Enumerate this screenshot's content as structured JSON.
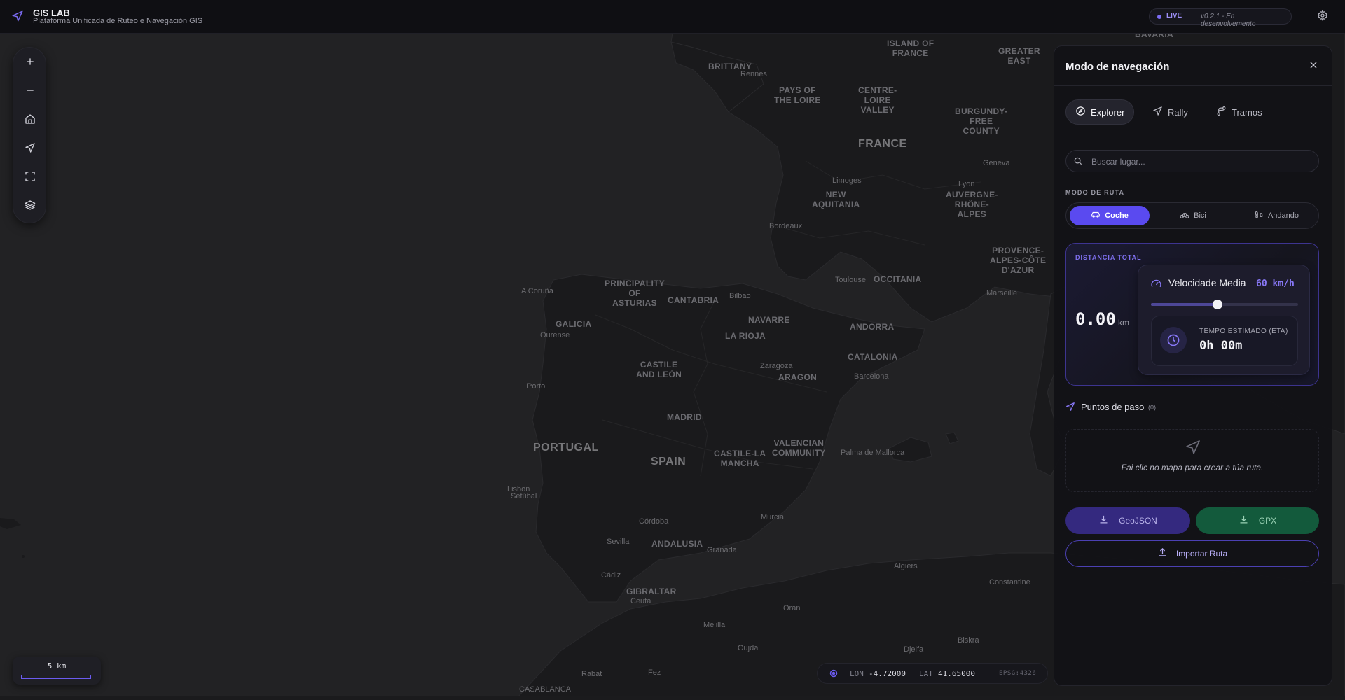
{
  "header": {
    "app_title": "GIS LAB",
    "app_subtitle": "Plataforma Unificada de Ruteo e Navegación GIS",
    "live_label": "LIVE",
    "version": "v0.2.1 - En desenvolvemento"
  },
  "map": {
    "country_labels": [
      "FRANCE",
      "SPAIN",
      "PORTUGAL"
    ],
    "region_labels": [
      "BRITTANY",
      "ISLAND OF\nFRANCE",
      "GREATER\nEAST",
      "PAYS OF\nTHE LOIRE",
      "CENTRE-\nLOIRE\nVALLEY",
      "BURGUNDY-\nFREE\nCOUNTY",
      "NEW\nAQUITANIA",
      "AUVERGNE-\nRHÔNE-\nALPES",
      "PROVENCE-\nALPES-CÔTE\nD'AZUR",
      "OCCITANIA",
      "PRINCIPALITY\nOF\nASTURIAS",
      "CANTABRIA",
      "NAVARRE",
      "GALICIA",
      "LA RIOJA",
      "ANDORRA",
      "CATALONIA",
      "CASTILE\nAND LEÓN",
      "ARAGON",
      "MADRID",
      "VALENCIAN\nCOMMUNITY",
      "CASTILE-LA\nMANCHA",
      "ANDALUSIA",
      "GIBRALTAR",
      "BAVARIA"
    ],
    "city_labels": [
      "Rennes",
      "Limoges",
      "Bordeaux",
      "Toulouse",
      "Lyon",
      "Geneva",
      "Marseille",
      "A Coruña",
      "Ourense",
      "Bilbao",
      "Zaragoza",
      "Barcelona",
      "Porto",
      "Lisbon",
      "Setúbal",
      "Palma de Mallorca",
      "Córdoba",
      "Sevilla",
      "Granada",
      "Murcia",
      "Cádiz",
      "Ceuta",
      "Melilla",
      "Oujda",
      "Oran",
      "Algiers",
      "Constantine",
      "Djelfa",
      "Biskra",
      "Fez",
      "Rabat",
      "CASABLANCA"
    ]
  },
  "map_controls": {
    "zoom_in": "zoom-in",
    "zoom_out": "zoom-out",
    "home": "home",
    "locate": "locate",
    "fullscreen": "fullscreen",
    "layers": "layers"
  },
  "scale": {
    "label": "5 km"
  },
  "coords": {
    "lon_label": "LON",
    "lon_value": "-4.72000",
    "lat_label": "LAT",
    "lat_value": "41.65000",
    "epsg": "EPSG:4326"
  },
  "panel": {
    "title": "Modo de navegación",
    "tabs": [
      {
        "label": "Explorer",
        "icon": "compass-icon",
        "active": true
      },
      {
        "label": "Rally",
        "icon": "navigation-arrow-icon",
        "active": false
      },
      {
        "label": "Tramos",
        "icon": "route-branch-icon",
        "active": false
      }
    ],
    "search": {
      "placeholder": "Buscar lugar..."
    },
    "route_mode_label": "MODO DE RUTA",
    "modes": [
      {
        "label": "Coche",
        "icon": "car-icon",
        "active": true
      },
      {
        "label": "Bici",
        "icon": "bike-icon",
        "active": false
      },
      {
        "label": "Andando",
        "icon": "footprints-icon",
        "active": false
      }
    ],
    "summary": {
      "distance_label": "DISTANCIA TOTAL",
      "distance_value": "0.00",
      "distance_unit": "km",
      "speed_label": "Velocidade Media",
      "speed_value": "60 km/h",
      "speed_fraction": 0.45,
      "eta_label": "TEMPO ESTIMADO (ETA)",
      "eta_value": "0h 00m"
    },
    "waypoints": {
      "label": "Puntos de paso",
      "count": "(0)",
      "empty_text": "Fai clic no mapa para crear a túa ruta."
    },
    "buttons": {
      "geojson": "GeoJSON",
      "gpx": "GPX",
      "import": "Importar Ruta"
    }
  },
  "colors": {
    "accent": "#5a4af0",
    "gpx_button": "#135a3c",
    "geojson_button": "#34297f",
    "header_bg": "#0f0f13",
    "map_land": "#1a1a1c",
    "map_sea": "#222224"
  }
}
